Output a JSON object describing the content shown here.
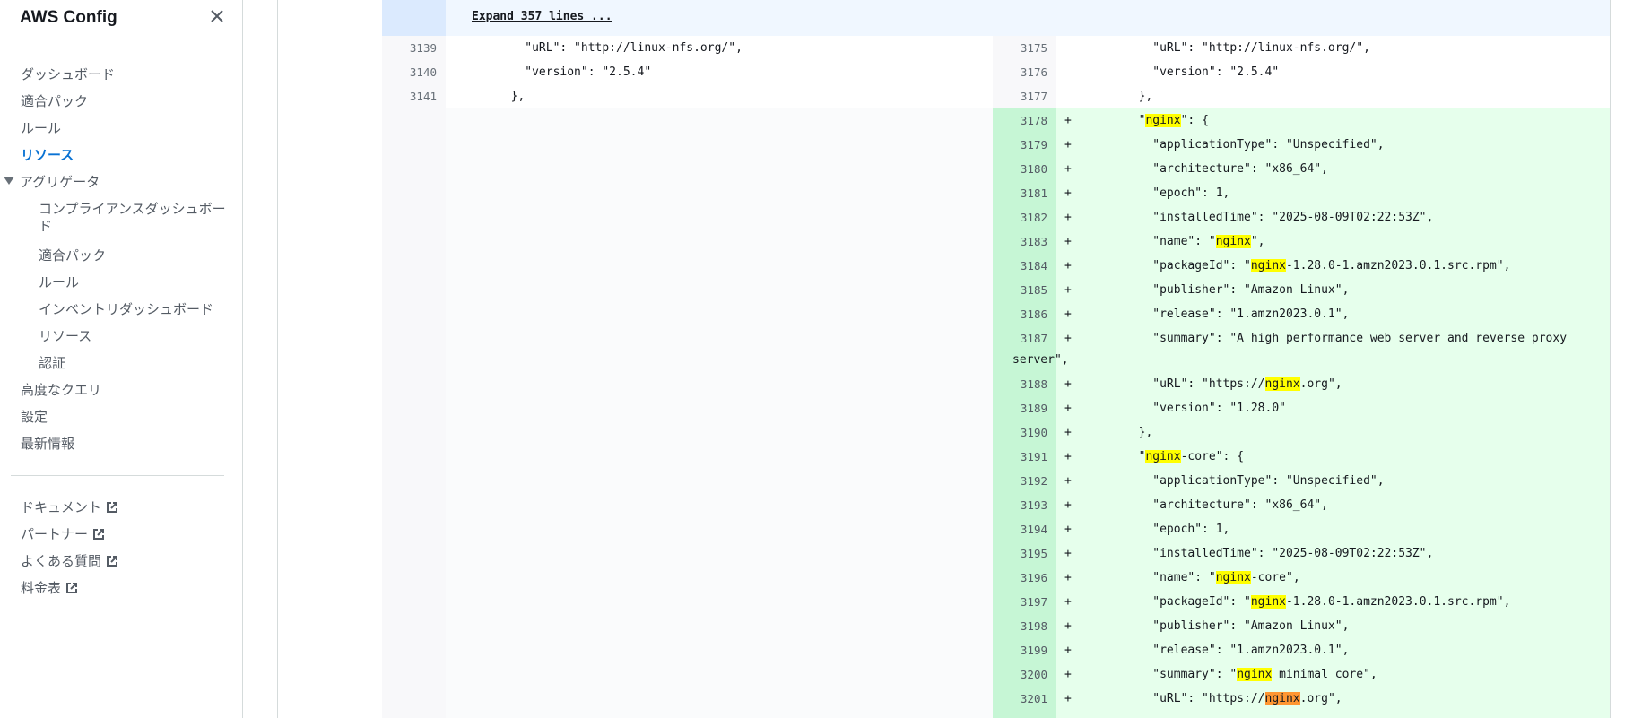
{
  "sidebar": {
    "title": "AWS Config",
    "items": [
      {
        "label": "ダッシュボード"
      },
      {
        "label": "適合パック"
      },
      {
        "label": "ルール"
      },
      {
        "label": "リソース"
      },
      {
        "label": "アグリゲータ"
      },
      {
        "label": "コンプライアンスダッシュボード"
      },
      {
        "label": "適合パック"
      },
      {
        "label": "ルール"
      },
      {
        "label": "インベントリダッシュボード"
      },
      {
        "label": "リソース"
      },
      {
        "label": "認証"
      },
      {
        "label": "高度なクエリ"
      },
      {
        "label": "設定"
      },
      {
        "label": "最新情報"
      }
    ],
    "links": [
      {
        "label": "ドキュメント"
      },
      {
        "label": "パートナー"
      },
      {
        "label": "よくある質問"
      },
      {
        "label": "料金表"
      }
    ],
    "active_item": "リソース"
  },
  "diff": {
    "expand_label": "Expand 357 lines ...",
    "search_term": "nginx",
    "left_lines": [
      {
        "num": "3139",
        "text": "          \"uRL\": \"http://linux-nfs.org/\","
      },
      {
        "num": "3140",
        "text": "          \"version\": \"2.5.4\""
      },
      {
        "num": "3141",
        "text": "        },"
      }
    ],
    "right_lines": [
      {
        "num": "3175",
        "text": "          \"uRL\": \"http://linux-nfs.org/\","
      },
      {
        "num": "3176",
        "text": "          \"version\": \"2.5.4\""
      },
      {
        "num": "3177",
        "text": "        },"
      },
      {
        "num": "3178",
        "text": "        \"nginx\": {",
        "added": true
      },
      {
        "num": "3179",
        "text": "          \"applicationType\": \"Unspecified\",",
        "added": true
      },
      {
        "num": "3180",
        "text": "          \"architecture\": \"x86_64\",",
        "added": true
      },
      {
        "num": "3181",
        "text": "          \"epoch\": 1,",
        "added": true
      },
      {
        "num": "3182",
        "text": "          \"installedTime\": \"2025-08-09T02:22:53Z\",",
        "added": true
      },
      {
        "num": "3183",
        "text": "          \"name\": \"nginx\",",
        "added": true
      },
      {
        "num": "3184",
        "text": "          \"packageId\": \"nginx-1.28.0-1.amzn2023.0.1.src.rpm\",",
        "added": true
      },
      {
        "num": "3185",
        "text": "          \"publisher\": \"Amazon Linux\",",
        "added": true
      },
      {
        "num": "3186",
        "text": "          \"release\": \"1.amzn2023.0.1\",",
        "added": true
      },
      {
        "num": "3187",
        "text": "          \"summary\": \"A high performance web server and reverse proxy",
        "cont": "server\",",
        "added": true
      },
      {
        "num": "3188",
        "text": "          \"uRL\": \"https://nginx.org\",",
        "added": true
      },
      {
        "num": "3189",
        "text": "          \"version\": \"1.28.0\"",
        "added": true
      },
      {
        "num": "3190",
        "text": "        },",
        "added": true
      },
      {
        "num": "3191",
        "text": "        \"nginx-core\": {",
        "added": true
      },
      {
        "num": "3192",
        "text": "          \"applicationType\": \"Unspecified\",",
        "added": true
      },
      {
        "num": "3193",
        "text": "          \"architecture\": \"x86_64\",",
        "added": true
      },
      {
        "num": "3194",
        "text": "          \"epoch\": 1,",
        "added": true
      },
      {
        "num": "3195",
        "text": "          \"installedTime\": \"2025-08-09T02:22:53Z\",",
        "added": true
      },
      {
        "num": "3196",
        "text": "          \"name\": \"nginx-core\",",
        "added": true
      },
      {
        "num": "3197",
        "text": "          \"packageId\": \"nginx-1.28.0-1.amzn2023.0.1.src.rpm\",",
        "added": true
      },
      {
        "num": "3198",
        "text": "          \"publisher\": \"Amazon Linux\",",
        "added": true
      },
      {
        "num": "3199",
        "text": "          \"release\": \"1.amzn2023.0.1\",",
        "added": true
      },
      {
        "num": "3200",
        "text": "          \"summary\": \"nginx minimal core\",",
        "added": true
      },
      {
        "num": "3201",
        "text": "          \"uRL\": \"https://nginx.org\",",
        "added": true,
        "current_match": true
      }
    ],
    "add_marker": "+"
  },
  "colors": {
    "accent": "#0972d3",
    "added_bg": "#e6ffec",
    "added_gutter": "#c6f6d5",
    "highlight": "#ffff00",
    "current_highlight": "#ff9632"
  },
  "icons": {
    "close": "close-icon",
    "external": "external-link-icon",
    "expand_caret": "caret-down-icon"
  }
}
